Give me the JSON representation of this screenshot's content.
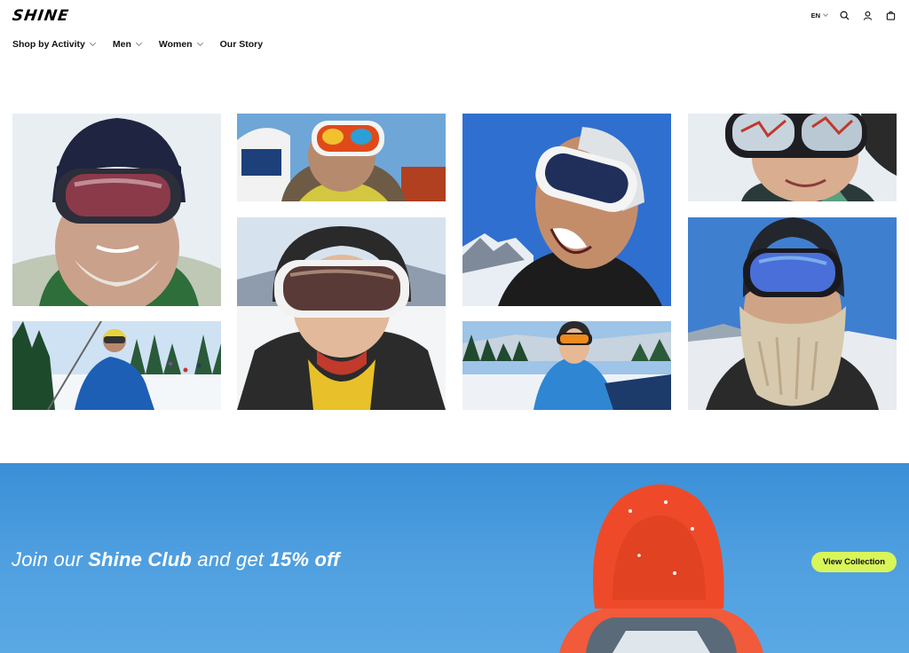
{
  "header": {
    "logo": "SHINE",
    "nav": [
      {
        "label": "Shop by Activity",
        "has_dropdown": true
      },
      {
        "label": "Men",
        "has_dropdown": true
      },
      {
        "label": "Women",
        "has_dropdown": true
      },
      {
        "label": "Our Story",
        "has_dropdown": false
      }
    ],
    "language": "EN",
    "icons": [
      "search-icon",
      "user-icon",
      "bag-icon"
    ]
  },
  "gallery": {
    "photos": [
      {
        "subject": "frosted-beard-skier-helmet"
      },
      {
        "subject": "skier-chairlift-blue-jacket"
      },
      {
        "subject": "man-mirrored-goggles-fur-hood"
      },
      {
        "subject": "child-helmet-white-goggles"
      },
      {
        "subject": "laughing-man-white-goggles"
      },
      {
        "subject": "kid-orange-goggles-slope"
      },
      {
        "subject": "smiling-woman-reflective-goggles"
      },
      {
        "subject": "frozen-beard-blue-goggles"
      }
    ]
  },
  "promo": {
    "text_prefix": "Join our ",
    "text_brand": "Shine Club",
    "text_middle": " and get ",
    "text_offer": "15% off",
    "button_label": "View Collection",
    "button_color": "#d8f55a",
    "background_color": "#4a9ade"
  }
}
